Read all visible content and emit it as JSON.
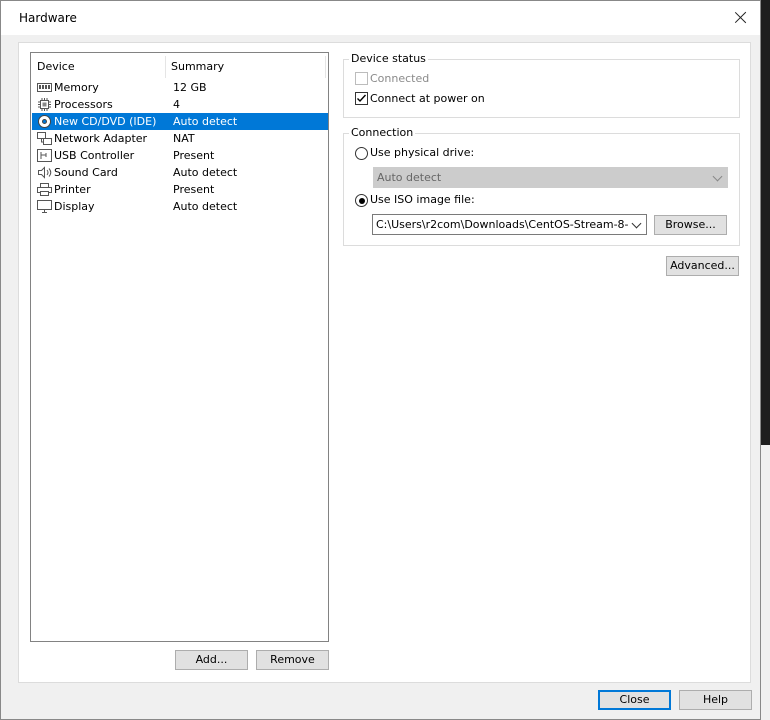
{
  "dialog": {
    "title": "Hardware"
  },
  "device_list": {
    "headers": {
      "device": "Device",
      "summary": "Summary"
    },
    "items": [
      {
        "icon": "memory-icon",
        "name": "Memory",
        "summary": "12 GB",
        "selected": false
      },
      {
        "icon": "processor-icon",
        "name": "Processors",
        "summary": "4",
        "selected": false
      },
      {
        "icon": "cd-dvd-icon",
        "name": "New CD/DVD (IDE)",
        "summary": "Auto detect",
        "selected": true
      },
      {
        "icon": "network-adapter-icon",
        "name": "Network Adapter",
        "summary": "NAT",
        "selected": false
      },
      {
        "icon": "usb-icon",
        "name": "USB Controller",
        "summary": "Present",
        "selected": false
      },
      {
        "icon": "speaker-icon",
        "name": "Sound Card",
        "summary": "Auto detect",
        "selected": false
      },
      {
        "icon": "printer-icon",
        "name": "Printer",
        "summary": "Present",
        "selected": false
      },
      {
        "icon": "display-icon",
        "name": "Display",
        "summary": "Auto detect",
        "selected": false
      }
    ],
    "add_label": "Add...",
    "remove_label": "Remove"
  },
  "device_status": {
    "label": "Device status",
    "connected_label": "Connected",
    "connected_checked": false,
    "connect_power_on_label": "Connect at power on",
    "connect_power_on_checked": true
  },
  "connection": {
    "label": "Connection",
    "physical_label": "Use physical drive:",
    "physical_value": "Auto detect",
    "iso_label": "Use ISO image file:",
    "iso_value": "C:\\Users\\r2com\\Downloads\\CentOS-Stream-8-",
    "browse_label": "Browse...",
    "selected": "iso"
  },
  "advanced_label": "Advanced...",
  "footer": {
    "close_label": "Close",
    "help_label": "Help"
  },
  "colors": {
    "selection": "#0078d7",
    "dialog_bg": "#f0f0f0"
  }
}
